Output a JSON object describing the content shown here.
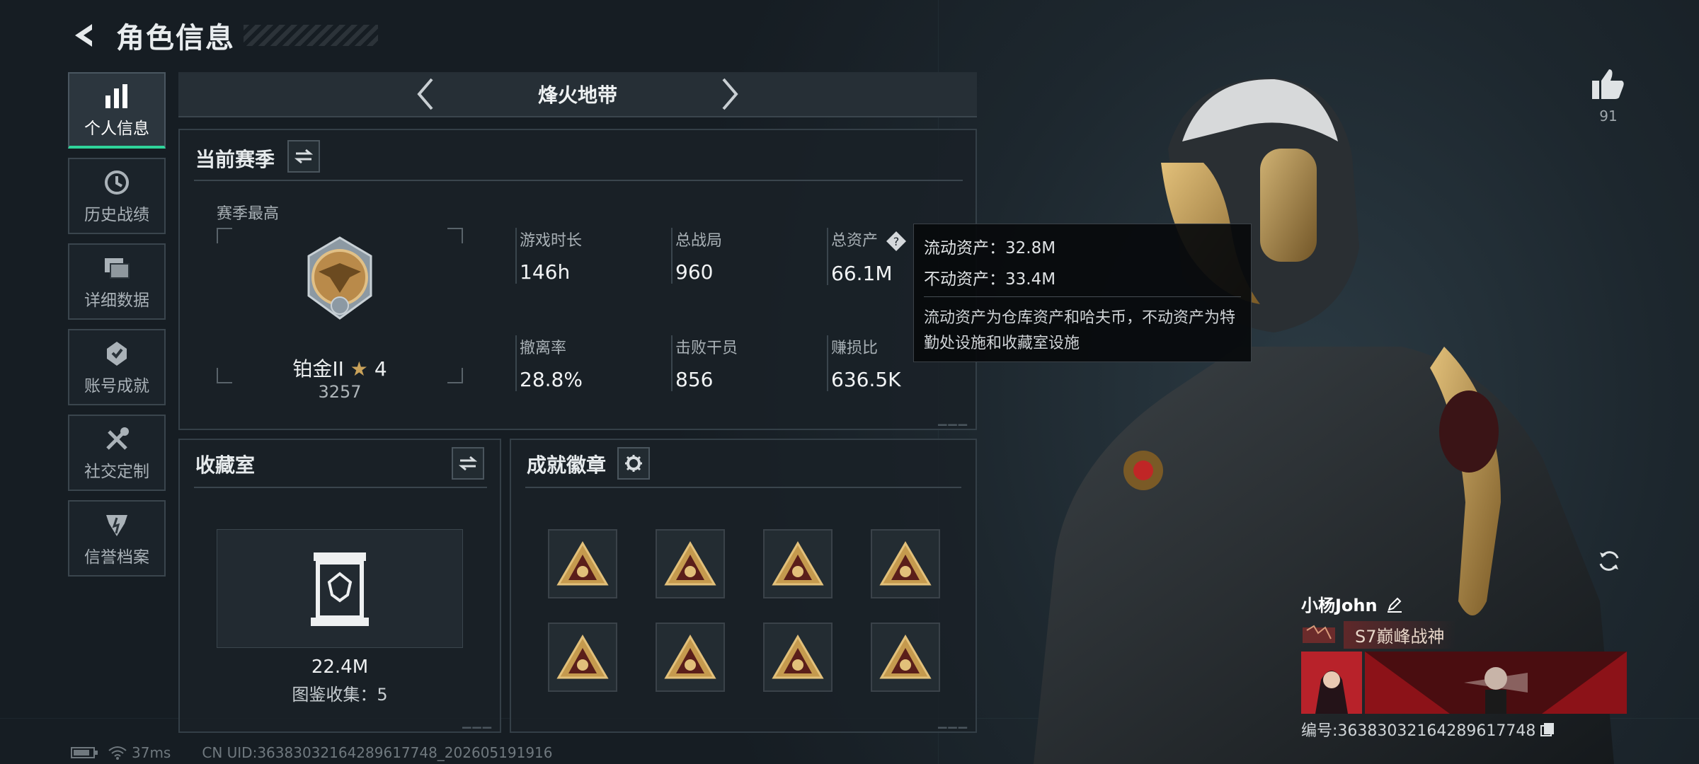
{
  "header": {
    "title": "角色信息"
  },
  "sidebar": {
    "items": [
      {
        "label": "个人信息",
        "active": true,
        "icon": "bar-chart-icon"
      },
      {
        "label": "历史战绩",
        "icon": "history-icon"
      },
      {
        "label": "详细数据",
        "icon": "data-cards-icon"
      },
      {
        "label": "账号成就",
        "icon": "achievement-icon"
      },
      {
        "label": "社交定制",
        "icon": "tools-icon"
      },
      {
        "label": "信誉档案",
        "icon": "reputation-icon"
      }
    ]
  },
  "mode": {
    "name": "烽火地带"
  },
  "season": {
    "title": "当前赛季",
    "best_label": "赛季最高",
    "rank_name": "铂金II",
    "rank_stars": "4",
    "rank_score": "3257",
    "stats": [
      {
        "label": "游戏时长",
        "value": "146h"
      },
      {
        "label": "总战局",
        "value": "960"
      },
      {
        "label": "总资产",
        "value": "66.1M"
      },
      {
        "label": "撤离率",
        "value": "28.8%"
      },
      {
        "label": "击败干员",
        "value": "856"
      },
      {
        "label": "赚损比",
        "value": "636.5K"
      }
    ]
  },
  "tooltip": {
    "liquid": "流动资产：32.8M",
    "fixed": "不动资产：33.4M",
    "desc": "流动资产为仓库资产和哈夫币，不动资产为特勤处设施和收藏室设施"
  },
  "collection": {
    "title": "收藏室",
    "value": "22.4M",
    "count_label": "图鉴收集：5"
  },
  "achievements": {
    "title": "成就徽章",
    "badge_count": 8
  },
  "like": {
    "count": "91"
  },
  "profile": {
    "name": "小杨John",
    "title": "S7巅峰战神",
    "uid_line": "编号:363830321642896177​48"
  },
  "footer": {
    "ping": "37ms",
    "uid": "CN UID:3638303216428961​7748_202605191916"
  },
  "colors": {
    "accent": "#2fd49a",
    "gold": "#c9a25a"
  }
}
